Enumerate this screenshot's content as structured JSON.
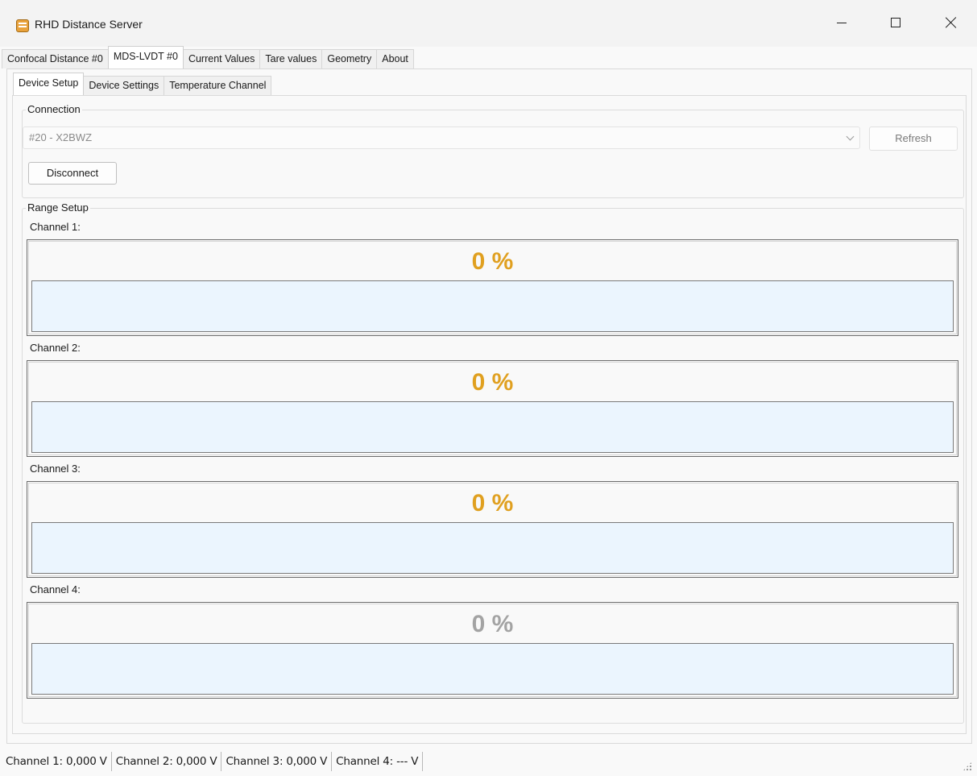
{
  "window": {
    "title": "RHD Distance Server",
    "icon": "dds-app-icon"
  },
  "outer_tabs": [
    {
      "label": "Confocal Distance #0",
      "active": false
    },
    {
      "label": "MDS-LVDT #0",
      "active": true
    },
    {
      "label": "Current Values",
      "active": false
    },
    {
      "label": "Tare values",
      "active": false
    },
    {
      "label": "Geometry",
      "active": false
    },
    {
      "label": "About",
      "active": false
    }
  ],
  "inner_tabs": [
    {
      "label": "Device Setup",
      "active": true
    },
    {
      "label": "Device Settings",
      "active": false
    },
    {
      "label": "Temperature Channel",
      "active": false
    }
  ],
  "connection": {
    "legend": "Connection",
    "device_selected": "#20 - X2BWZ",
    "refresh_label": "Refresh",
    "disconnect_label": "Disconnect"
  },
  "range_setup": {
    "legend": "Range Setup",
    "channels": [
      {
        "label": "Channel 1:",
        "percent_text": "0 %",
        "fill_percent": 0,
        "color": "#e0a020"
      },
      {
        "label": "Channel 2:",
        "percent_text": "0 %",
        "fill_percent": 0,
        "color": "#e0a020"
      },
      {
        "label": "Channel 3:",
        "percent_text": "0 %",
        "fill_percent": 0,
        "color": "#e0a020"
      },
      {
        "label": "Channel 4:",
        "percent_text": "0 %",
        "fill_percent": 0,
        "color": "#a3a3a3"
      }
    ]
  },
  "status_bar": [
    "Channel 1: 0,000 V",
    "Channel 2: 0,000 V",
    "Channel 3: 0,000 V",
    "Channel 4: --- V"
  ],
  "colors": {
    "accent_orange": "#e0a020",
    "disabled_gray": "#a3a3a3",
    "bar_background": "#ebf5fe"
  }
}
